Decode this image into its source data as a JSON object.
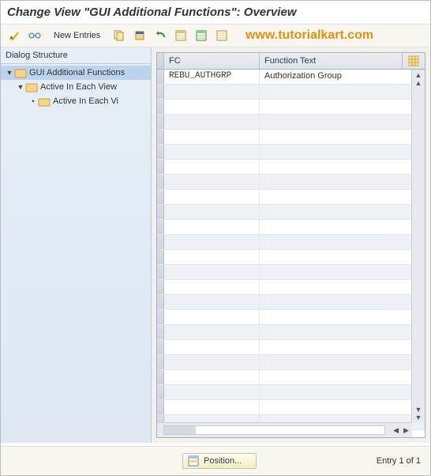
{
  "title": "Change View \"GUI Additional Functions\": Overview",
  "watermark": "www.tutorialkart.com",
  "toolbar": {
    "new_entries": "New Entries"
  },
  "tree": {
    "header": "Dialog Structure",
    "nodes": [
      {
        "label": "GUI Additional Functions",
        "level": 0,
        "open": true,
        "selected": true
      },
      {
        "label": "Active In Each View",
        "level": 1,
        "open": true,
        "selected": false
      },
      {
        "label": "Active In Each Vi",
        "level": 2,
        "open": false,
        "selected": false
      }
    ]
  },
  "grid": {
    "columns": {
      "fc": "FC",
      "ft": "Function Text"
    },
    "rows": [
      {
        "fc": "REBU_AUTHGRP",
        "ft": "Authorization Group"
      },
      {
        "fc": "",
        "ft": ""
      },
      {
        "fc": "",
        "ft": ""
      },
      {
        "fc": "",
        "ft": ""
      },
      {
        "fc": "",
        "ft": ""
      },
      {
        "fc": "",
        "ft": ""
      },
      {
        "fc": "",
        "ft": ""
      },
      {
        "fc": "",
        "ft": ""
      },
      {
        "fc": "",
        "ft": ""
      },
      {
        "fc": "",
        "ft": ""
      },
      {
        "fc": "",
        "ft": ""
      },
      {
        "fc": "",
        "ft": ""
      },
      {
        "fc": "",
        "ft": ""
      },
      {
        "fc": "",
        "ft": ""
      },
      {
        "fc": "",
        "ft": ""
      },
      {
        "fc": "",
        "ft": ""
      },
      {
        "fc": "",
        "ft": ""
      },
      {
        "fc": "",
        "ft": ""
      },
      {
        "fc": "",
        "ft": ""
      },
      {
        "fc": "",
        "ft": ""
      },
      {
        "fc": "",
        "ft": ""
      },
      {
        "fc": "",
        "ft": ""
      },
      {
        "fc": "",
        "ft": ""
      },
      {
        "fc": "",
        "ft": ""
      }
    ]
  },
  "footer": {
    "position": "Position...",
    "entry": "Entry 1 of 1"
  }
}
